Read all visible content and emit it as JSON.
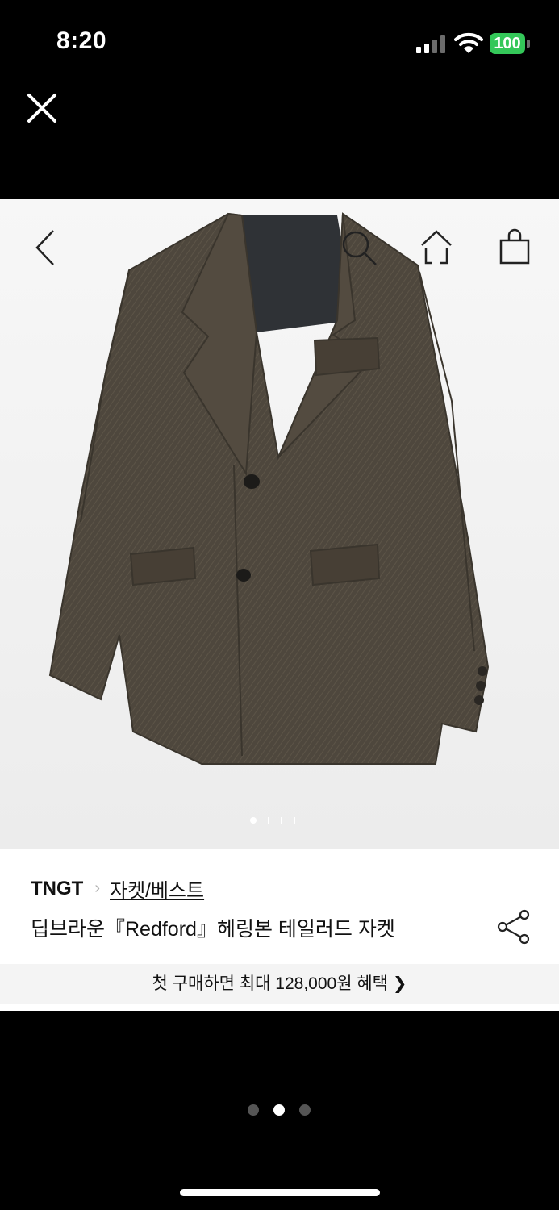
{
  "status_bar": {
    "time": "8:20",
    "battery": "100"
  },
  "product": {
    "brand": "TNGT",
    "category": "자켓/베스트",
    "title": "딥브라운『Redford』헤링본 테일러드 자켓",
    "image_count": 4,
    "current_image": 1
  },
  "benefit_banner": "첫 구매하면 최대 128,000원 혜택 ❯",
  "pager": {
    "pages": 3,
    "current": 2
  },
  "colors": {
    "accent": "#34c759",
    "jacket": "#4e473d",
    "background": "#000000"
  }
}
